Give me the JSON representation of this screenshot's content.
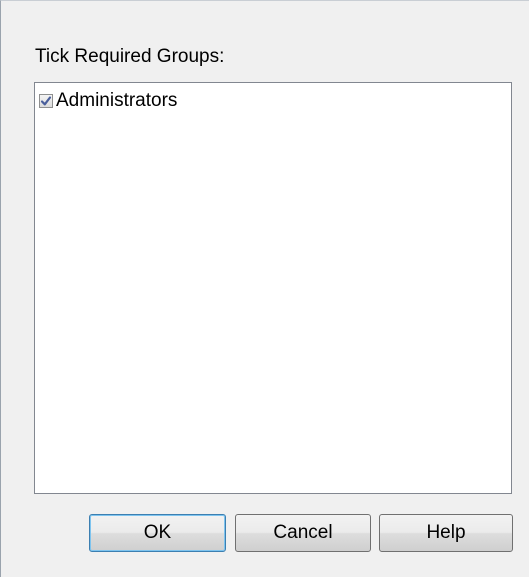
{
  "dialog": {
    "group_label": "Tick Required Groups:",
    "groups": [
      {
        "label": "Administrators",
        "checked": true
      }
    ]
  },
  "buttons": {
    "ok_label": "OK",
    "cancel_label": "Cancel",
    "help_label": "Help"
  },
  "icons": {
    "checkbox": "checkmark-icon"
  },
  "colors": {
    "check": "#4a5f9c",
    "default_button_border": "#3c7fb1"
  }
}
